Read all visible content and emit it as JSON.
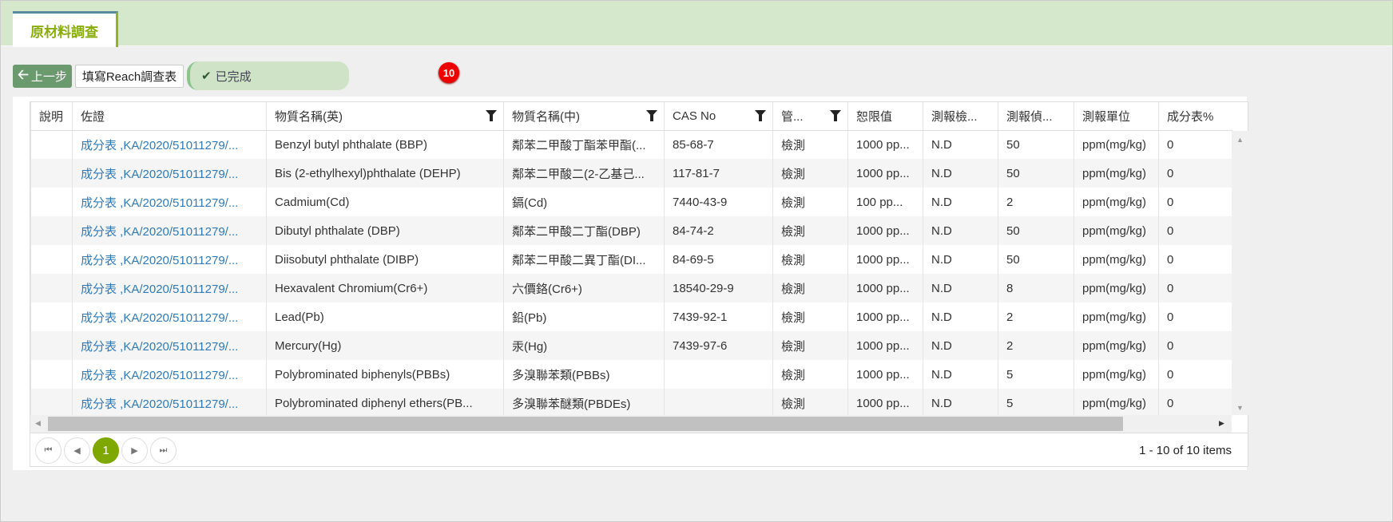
{
  "tab": {
    "label": "原材料調查"
  },
  "toolbar": {
    "back_label": "上一步",
    "reach_label": "填寫Reach調查表",
    "status_label": "已完成",
    "badge_count": "10"
  },
  "colors": {
    "tab_text": "#8aad0e",
    "link": "#2f7ab8",
    "pager_active": "#7ea700",
    "badge": "#e00000"
  },
  "table": {
    "columns": [
      "說明",
      "佐證",
      "物質名稱(英)",
      "物質名稱(中)",
      "CAS No",
      "管...",
      "恕限值",
      "測報檢...",
      "測報偵...",
      "測報單位",
      "成分表%"
    ],
    "filterable": [
      false,
      false,
      true,
      true,
      true,
      true,
      false,
      false,
      false,
      false,
      false
    ],
    "rows": [
      [
        "",
        "成分表 ,KA/2020/51011279/...",
        "Benzyl butyl phthalate (BBP)",
        "鄰苯二甲酸丁酯苯甲酯(...",
        "85-68-7",
        "檢測",
        "1000 pp...",
        "N.D",
        "50",
        "ppm(mg/kg)",
        "0"
      ],
      [
        "",
        "成分表 ,KA/2020/51011279/...",
        "Bis (2-ethylhexyl)phthalate (DEHP)",
        "鄰苯二甲酸二(2-乙基己...",
        "117-81-7",
        "檢測",
        "1000 pp...",
        "N.D",
        "50",
        "ppm(mg/kg)",
        "0"
      ],
      [
        "",
        "成分表 ,KA/2020/51011279/...",
        "Cadmium(Cd)",
        "鎘(Cd)",
        "7440-43-9",
        "檢測",
        "100 pp...",
        "N.D",
        "2",
        "ppm(mg/kg)",
        "0"
      ],
      [
        "",
        "成分表 ,KA/2020/51011279/...",
        "Dibutyl phthalate (DBP)",
        "鄰苯二甲酸二丁酯(DBP)",
        "84-74-2",
        "檢測",
        "1000 pp...",
        "N.D",
        "50",
        "ppm(mg/kg)",
        "0"
      ],
      [
        "",
        "成分表 ,KA/2020/51011279/...",
        "Diisobutyl phthalate (DIBP)",
        "鄰苯二甲酸二異丁酯(DI...",
        "84-69-5",
        "檢測",
        "1000 pp...",
        "N.D",
        "50",
        "ppm(mg/kg)",
        "0"
      ],
      [
        "",
        "成分表 ,KA/2020/51011279/...",
        "Hexavalent Chromium(Cr6+)",
        "六價鉻(Cr6+)",
        "18540-29-9",
        "檢測",
        "1000 pp...",
        "N.D",
        "8",
        "ppm(mg/kg)",
        "0"
      ],
      [
        "",
        "成分表 ,KA/2020/51011279/...",
        "Lead(Pb)",
        "鉛(Pb)",
        "7439-92-1",
        "檢測",
        "1000 pp...",
        "N.D",
        "2",
        "ppm(mg/kg)",
        "0"
      ],
      [
        "",
        "成分表 ,KA/2020/51011279/...",
        "Mercury(Hg)",
        "汞(Hg)",
        "7439-97-6",
        "檢測",
        "1000 pp...",
        "N.D",
        "2",
        "ppm(mg/kg)",
        "0"
      ],
      [
        "",
        "成分表 ,KA/2020/51011279/...",
        "Polybrominated biphenyls(PBBs)",
        "多溴聯苯類(PBBs)",
        "",
        "檢測",
        "1000 pp...",
        "N.D",
        "5",
        "ppm(mg/kg)",
        "0"
      ],
      [
        "",
        "成分表 ,KA/2020/51011279/...",
        "Polybrominated diphenyl ethers(PB...",
        "多溴聯苯醚類(PBDEs)",
        "",
        "檢測",
        "1000 pp...",
        "N.D",
        "5",
        "ppm(mg/kg)",
        "0"
      ]
    ]
  },
  "pager": {
    "current_page": "1",
    "info": "1 - 10 of 10 items"
  }
}
